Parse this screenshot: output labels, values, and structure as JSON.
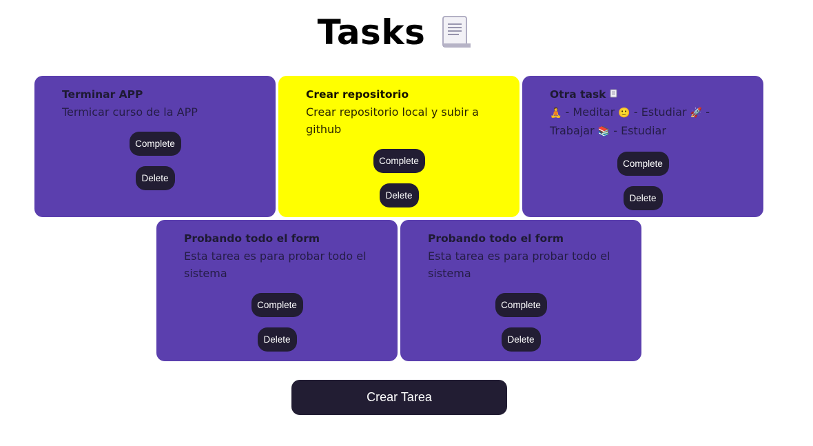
{
  "header": {
    "title": "Tasks",
    "icon": "document-icon"
  },
  "tasks": [
    {
      "title": "Terminar APP",
      "description": "Termicar curso de la APP",
      "completed": false,
      "complete_label": "Complete",
      "delete_label": "Delete"
    },
    {
      "title": "Crear repositorio",
      "description": "Crear repositorio local y subir a github",
      "completed": true,
      "complete_label": "Complete",
      "delete_label": "Delete"
    },
    {
      "title": "Otra task",
      "description_parts": [
        " - Meditar ",
        " - Estudiar ",
        " - ",
        "Trabajar ",
        " - Estudiar"
      ],
      "completed": false,
      "complete_label": "Complete",
      "delete_label": "Delete"
    },
    {
      "title": "Probando todo el form",
      "description": "Esta tarea es para probar todo el sistema",
      "completed": false,
      "complete_label": "Complete",
      "delete_label": "Delete"
    },
    {
      "title": "Probando todo el form",
      "description": "Esta tarea es para probar todo el sistema",
      "completed": false,
      "complete_label": "Complete",
      "delete_label": "Delete"
    }
  ],
  "create_button_label": "Crear Tarea",
  "colors": {
    "card": "#5b3fae",
    "card_completed": "#ffff00",
    "button": "#221d33"
  }
}
